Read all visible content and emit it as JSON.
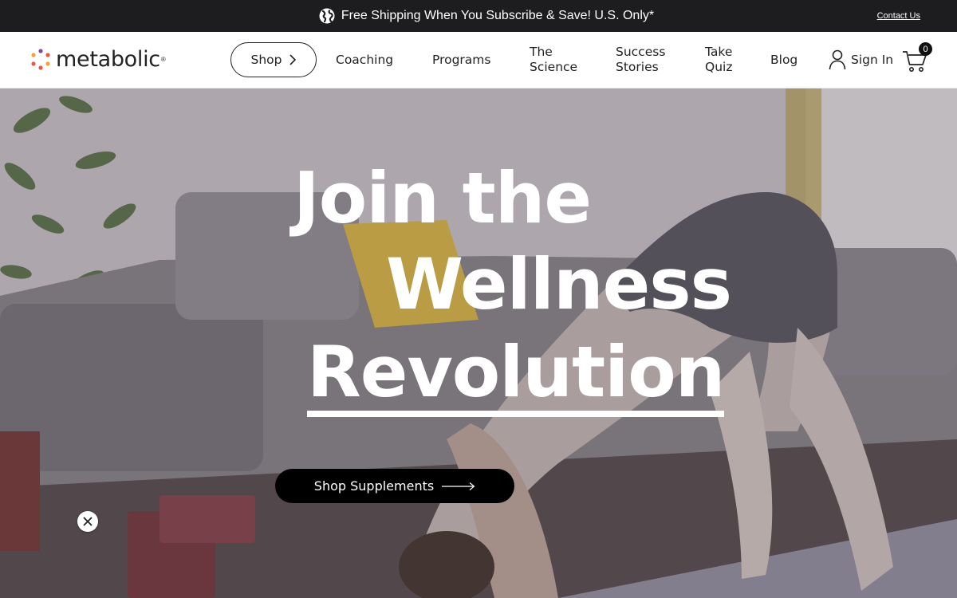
{
  "topbar": {
    "promo_text": "Free Shipping When You Subscribe & Save! U.S. Only*",
    "contact_link": "Contact Us"
  },
  "header": {
    "logo_text": "metabolic",
    "logo_mark": "®",
    "nav": {
      "shop": "Shop",
      "coaching": "Coaching",
      "programs": "Programs",
      "science_line1": "The",
      "science_line2": "Science",
      "success_line1": "Success",
      "success_line2": "Stories",
      "quiz_line1": "Take",
      "quiz_line2": "Quiz",
      "blog": "Blog"
    },
    "sign_in": "Sign In",
    "cart_count": "0"
  },
  "hero": {
    "line1": "Join the",
    "line2": "Wellness",
    "line3": "Revolution",
    "cta_label": "Shop Supplements"
  },
  "icons": {
    "globe": "globe-icon",
    "chevron": "chevron-right-icon",
    "user": "user-icon",
    "cart": "cart-icon",
    "arrow": "arrow-right-icon",
    "close": "close-icon"
  },
  "colors": {
    "topbar_bg": "#1d1d1f",
    "cta_bg": "#000000",
    "logo_dots": [
      "#e8584a",
      "#f0a33b",
      "#7b4b9e",
      "#e8584a",
      "#f0a33b"
    ]
  }
}
